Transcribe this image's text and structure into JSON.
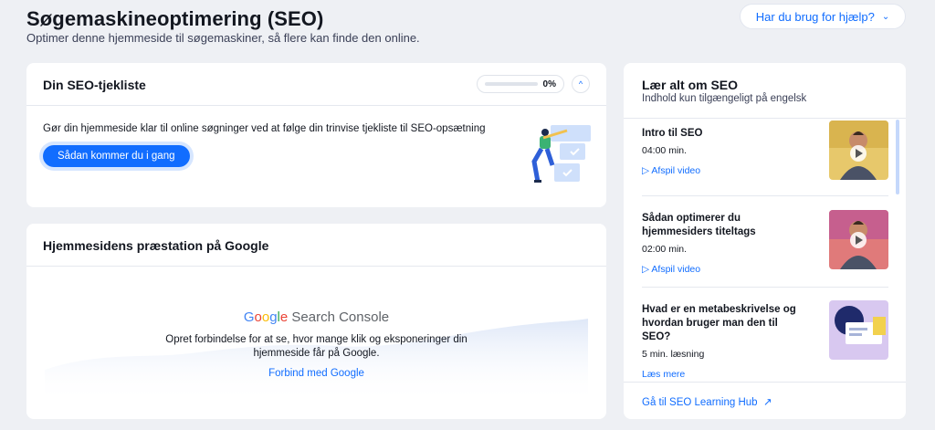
{
  "header": {
    "title": "Søgemaskineoptimering (SEO)",
    "subtitle": "Optimer denne hjemmeside til søgemaskiner, så flere kan finde den online.",
    "help_label": "Har du brug for hjælp?"
  },
  "checklist": {
    "title": "Din SEO-tjekliste",
    "progress_text": "0%",
    "progress_fraction": 0,
    "description": "Gør din hjemmeside klar til online søgninger ved at følge din trinvise tjekliste til SEO-opsætning",
    "start_label": "Sådan kommer du i gang"
  },
  "performance": {
    "title": "Hjemmesidens præstation på Google",
    "logo_word1": "Google",
    "logo_word2": " Search Console",
    "text_line1": "Opret forbindelse for at se, hvor mange klik og eksponeringer din",
    "text_line2": "hjemmeside får på Google.",
    "connect_label": "Forbind med Google"
  },
  "learn": {
    "title": "Lær alt om SEO",
    "subtitle": "Indhold kun tilgængeligt på engelsk",
    "lessons": [
      {
        "title": "Intro til SEO",
        "meta": "04:00 min.",
        "link": "Afspil video",
        "link_icon": "play-icon"
      },
      {
        "title": "Sådan optimerer du hjemmesiders titeltags",
        "meta": "02:00 min.",
        "link": "Afspil video",
        "link_icon": "play-icon"
      },
      {
        "title": "Hvad er en metabeskrivelse og hvordan bruger man den til SEO?",
        "meta": "5 min. læsning",
        "link": "Læs mere"
      }
    ],
    "hub_link": "Gå til SEO Learning Hub"
  },
  "colors": {
    "accent": "#116dff",
    "background": "#eef0f4"
  }
}
